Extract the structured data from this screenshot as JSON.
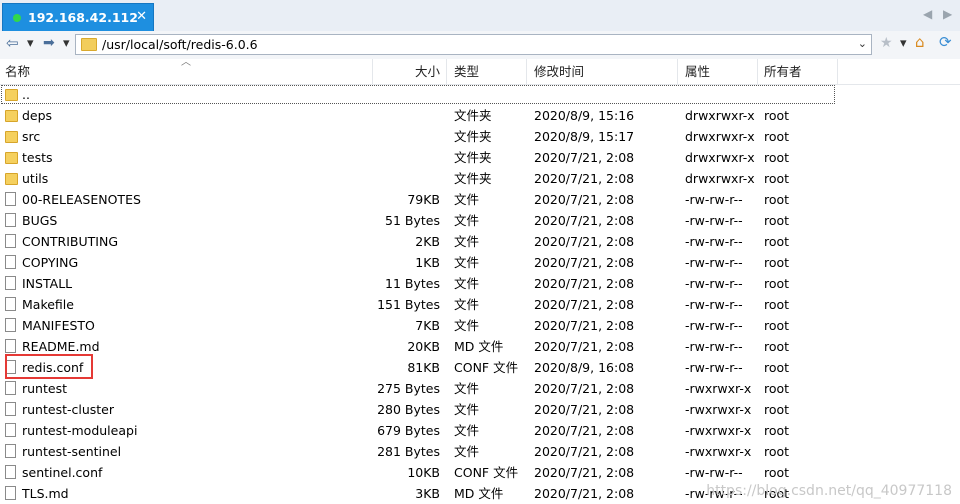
{
  "tab": {
    "title": "192.168.42.112",
    "close": "✕"
  },
  "window_arrows": {
    "left": "◀",
    "right": "▶"
  },
  "toolbar": {
    "back": "⇦",
    "back_dropdown": "▾",
    "forward": "➡",
    "address": "/usr/local/soft/redis-6.0.6",
    "address_dropdown": "⌄",
    "bookmark": "★",
    "bookmark_dropdown": "▾",
    "home": "⌂",
    "refresh": "⟳"
  },
  "columns": {
    "name": "名称",
    "size": "大小",
    "type": "类型",
    "modified": "修改时间",
    "attr": "属性",
    "owner": "所有者"
  },
  "parent": {
    "name": ".."
  },
  "files": [
    {
      "name": "deps",
      "size": "",
      "type": "文件夹",
      "modified": "2020/8/9, 15:16",
      "attr": "drwxrwxr-x",
      "owner": "root",
      "icon": "folder"
    },
    {
      "name": "src",
      "size": "",
      "type": "文件夹",
      "modified": "2020/8/9, 15:17",
      "attr": "drwxrwxr-x",
      "owner": "root",
      "icon": "folder"
    },
    {
      "name": "tests",
      "size": "",
      "type": "文件夹",
      "modified": "2020/7/21, 2:08",
      "attr": "drwxrwxr-x",
      "owner": "root",
      "icon": "folder"
    },
    {
      "name": "utils",
      "size": "",
      "type": "文件夹",
      "modified": "2020/7/21, 2:08",
      "attr": "drwxrwxr-x",
      "owner": "root",
      "icon": "folder"
    },
    {
      "name": "00-RELEASENOTES",
      "size": "79KB",
      "type": "文件",
      "modified": "2020/7/21, 2:08",
      "attr": "-rw-rw-r--",
      "owner": "root",
      "icon": "file"
    },
    {
      "name": "BUGS",
      "size": "51 Bytes",
      "type": "文件",
      "modified": "2020/7/21, 2:08",
      "attr": "-rw-rw-r--",
      "owner": "root",
      "icon": "file"
    },
    {
      "name": "CONTRIBUTING",
      "size": "2KB",
      "type": "文件",
      "modified": "2020/7/21, 2:08",
      "attr": "-rw-rw-r--",
      "owner": "root",
      "icon": "file"
    },
    {
      "name": "COPYING",
      "size": "1KB",
      "type": "文件",
      "modified": "2020/7/21, 2:08",
      "attr": "-rw-rw-r--",
      "owner": "root",
      "icon": "file"
    },
    {
      "name": "INSTALL",
      "size": "11 Bytes",
      "type": "文件",
      "modified": "2020/7/21, 2:08",
      "attr": "-rw-rw-r--",
      "owner": "root",
      "icon": "file"
    },
    {
      "name": "Makefile",
      "size": "151 Bytes",
      "type": "文件",
      "modified": "2020/7/21, 2:08",
      "attr": "-rw-rw-r--",
      "owner": "root",
      "icon": "file"
    },
    {
      "name": "MANIFESTO",
      "size": "7KB",
      "type": "文件",
      "modified": "2020/7/21, 2:08",
      "attr": "-rw-rw-r--",
      "owner": "root",
      "icon": "file"
    },
    {
      "name": "README.md",
      "size": "20KB",
      "type": "MD 文件",
      "modified": "2020/7/21, 2:08",
      "attr": "-rw-rw-r--",
      "owner": "root",
      "icon": "file"
    },
    {
      "name": "redis.conf",
      "size": "81KB",
      "type": "CONF 文件",
      "modified": "2020/8/9, 16:08",
      "attr": "-rw-rw-r--",
      "owner": "root",
      "icon": "file"
    },
    {
      "name": "runtest",
      "size": "275 Bytes",
      "type": "文件",
      "modified": "2020/7/21, 2:08",
      "attr": "-rwxrwxr-x",
      "owner": "root",
      "icon": "file"
    },
    {
      "name": "runtest-cluster",
      "size": "280 Bytes",
      "type": "文件",
      "modified": "2020/7/21, 2:08",
      "attr": "-rwxrwxr-x",
      "owner": "root",
      "icon": "file"
    },
    {
      "name": "runtest-moduleapi",
      "size": "679 Bytes",
      "type": "文件",
      "modified": "2020/7/21, 2:08",
      "attr": "-rwxrwxr-x",
      "owner": "root",
      "icon": "file"
    },
    {
      "name": "runtest-sentinel",
      "size": "281 Bytes",
      "type": "文件",
      "modified": "2020/7/21, 2:08",
      "attr": "-rwxrwxr-x",
      "owner": "root",
      "icon": "file"
    },
    {
      "name": "sentinel.conf",
      "size": "10KB",
      "type": "CONF 文件",
      "modified": "2020/7/21, 2:08",
      "attr": "-rw-rw-r--",
      "owner": "root",
      "icon": "file"
    },
    {
      "name": "TLS.md",
      "size": "3KB",
      "type": "MD 文件",
      "modified": "2020/7/21, 2:08",
      "attr": "-rw-rw-r--",
      "owner": "root",
      "icon": "file"
    }
  ],
  "watermark": "https://blog.csdn.net/qq_40977118",
  "colors": {
    "tab_active": "#1e8fe0",
    "highlight_box": "#e53935",
    "folder": "#f5d05e"
  }
}
